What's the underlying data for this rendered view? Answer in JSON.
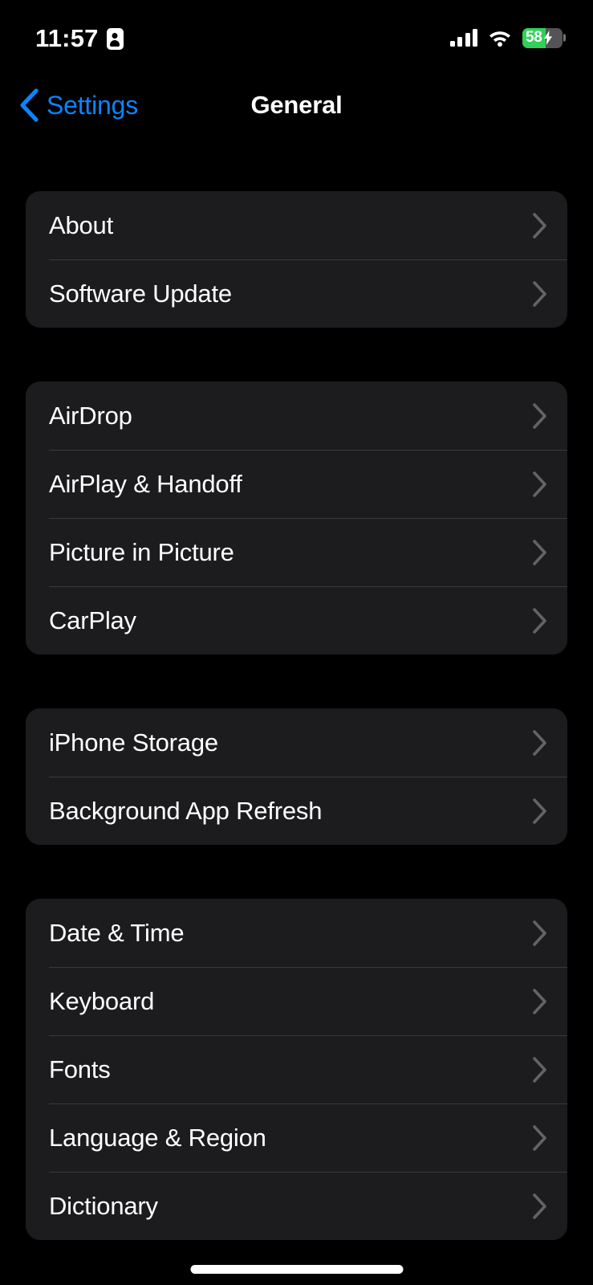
{
  "status_bar": {
    "time": "11:57",
    "badge_icon": "person-badge-icon",
    "cellular_icon": "cellular-signal-icon",
    "cellular_bars": 4,
    "wifi_icon": "wifi-icon",
    "battery": {
      "percent_label": "58",
      "percent_value": 58,
      "charging": true,
      "fill_color": "#30D158",
      "track_color": "#545458",
      "bolt_icon": "lightning-bolt-icon"
    }
  },
  "nav": {
    "back_icon": "chevron-left-icon",
    "back_label": "Settings",
    "title": "General",
    "accent_color": "#0A84FF"
  },
  "colors": {
    "page_background": "#000000",
    "card_background": "#1C1C1E",
    "separator": "#3A3A3C",
    "chevron": "#636366",
    "primary_text": "#FFFFFF"
  },
  "groups": [
    {
      "rows": [
        {
          "label": "About",
          "chevron_icon": "chevron-right-icon"
        },
        {
          "label": "Software Update",
          "chevron_icon": "chevron-right-icon"
        }
      ]
    },
    {
      "rows": [
        {
          "label": "AirDrop",
          "chevron_icon": "chevron-right-icon"
        },
        {
          "label": "AirPlay & Handoff",
          "chevron_icon": "chevron-right-icon"
        },
        {
          "label": "Picture in Picture",
          "chevron_icon": "chevron-right-icon"
        },
        {
          "label": "CarPlay",
          "chevron_icon": "chevron-right-icon"
        }
      ]
    },
    {
      "rows": [
        {
          "label": "iPhone Storage",
          "chevron_icon": "chevron-right-icon"
        },
        {
          "label": "Background App Refresh",
          "chevron_icon": "chevron-right-icon"
        }
      ]
    },
    {
      "rows": [
        {
          "label": "Date & Time",
          "chevron_icon": "chevron-right-icon"
        },
        {
          "label": "Keyboard",
          "chevron_icon": "chevron-right-icon"
        },
        {
          "label": "Fonts",
          "chevron_icon": "chevron-right-icon"
        },
        {
          "label": "Language & Region",
          "chevron_icon": "chevron-right-icon"
        },
        {
          "label": "Dictionary",
          "chevron_icon": "chevron-right-icon"
        }
      ]
    }
  ],
  "home_indicator": "home-indicator"
}
